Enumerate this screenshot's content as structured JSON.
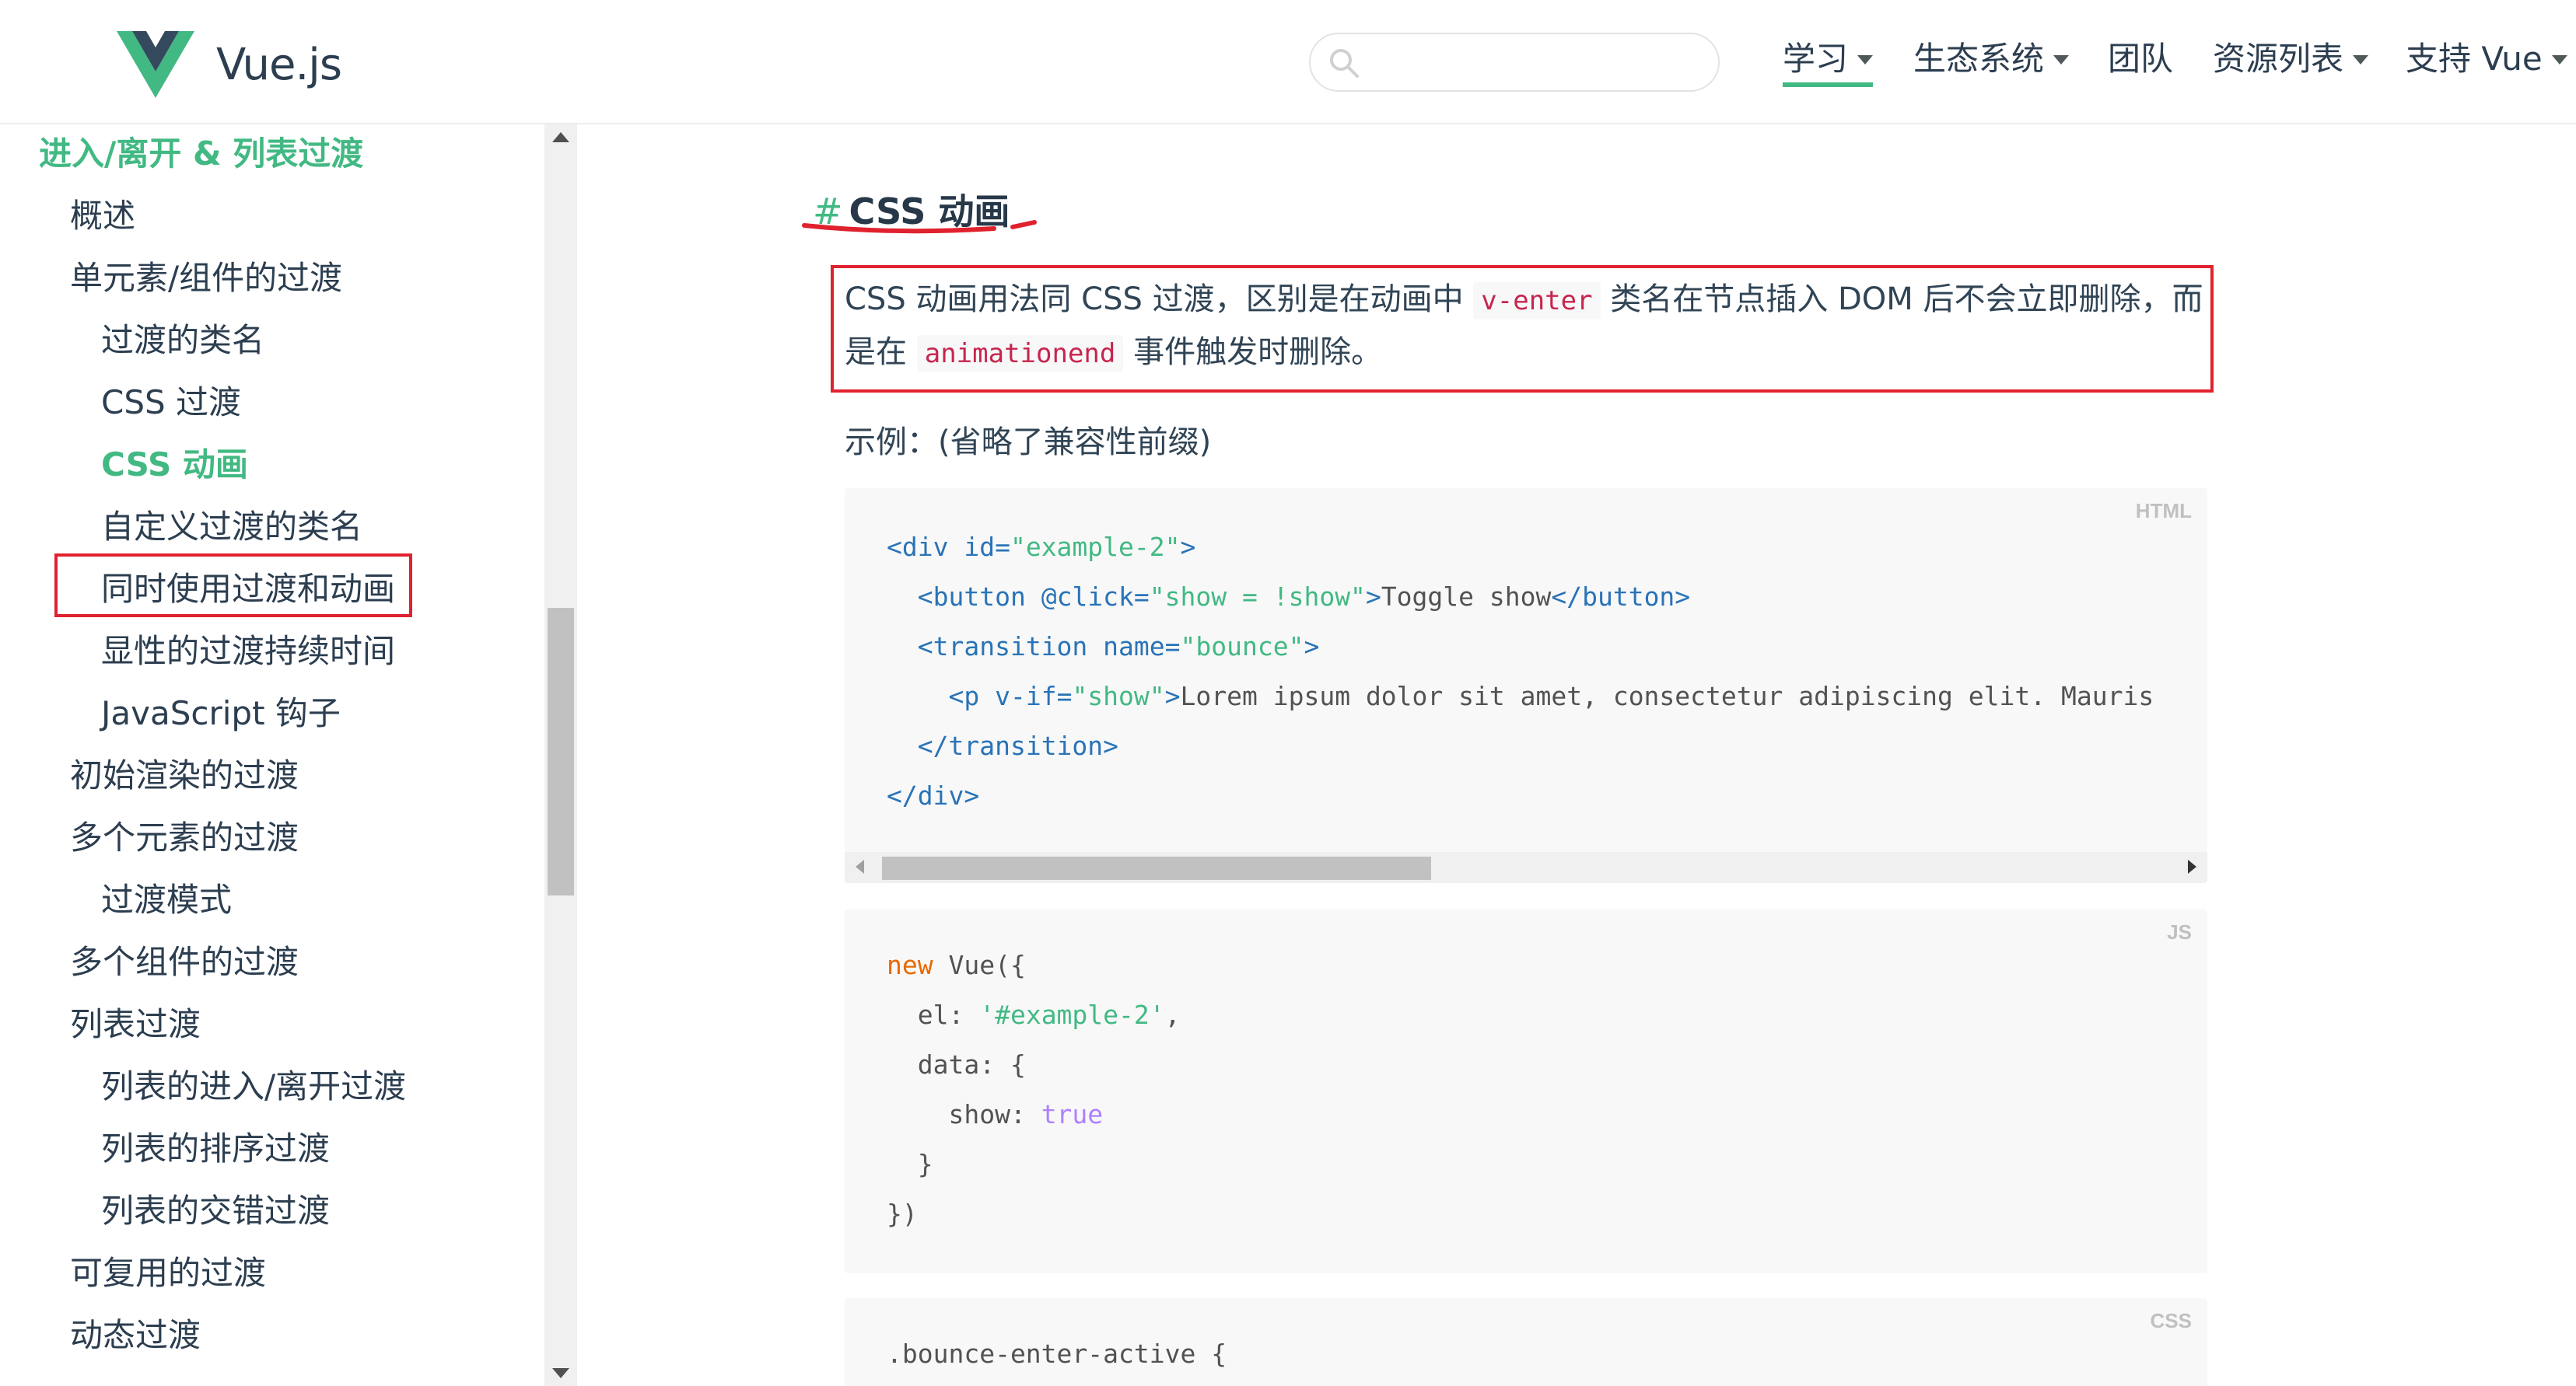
{
  "header": {
    "logo_text": "Vue.js",
    "search_placeholder": "",
    "nav": [
      {
        "label": "学习",
        "dropdown": true,
        "active": true
      },
      {
        "label": "生态系统",
        "dropdown": true,
        "active": false
      },
      {
        "label": "团队",
        "dropdown": false,
        "active": false
      },
      {
        "label": "资源列表",
        "dropdown": true,
        "active": false
      },
      {
        "label": "支持 Vue",
        "dropdown": true,
        "active": false
      }
    ]
  },
  "sidebar": {
    "section_title": "进入/离开 & 列表过渡",
    "items": [
      {
        "label": "概述",
        "level": 1
      },
      {
        "label": "单元素/组件的过渡",
        "level": 1
      },
      {
        "label": "过渡的类名",
        "level": 2
      },
      {
        "label": "CSS 过渡",
        "level": 2
      },
      {
        "label": "CSS 动画",
        "level": 2,
        "active": true
      },
      {
        "label": "自定义过渡的类名",
        "level": 2
      },
      {
        "label": "同时使用过渡和动画",
        "level": 2
      },
      {
        "label": "显性的过渡持续时间",
        "level": 2
      },
      {
        "label": "JavaScript 钩子",
        "level": 2
      },
      {
        "label": "初始渲染的过渡",
        "level": 1
      },
      {
        "label": "多个元素的过渡",
        "level": 1
      },
      {
        "label": "过渡模式",
        "level": 2
      },
      {
        "label": "多个组件的过渡",
        "level": 1
      },
      {
        "label": "列表过渡",
        "level": 1
      },
      {
        "label": "列表的进入/离开过渡",
        "level": 2
      },
      {
        "label": "列表的排序过渡",
        "level": 2
      },
      {
        "label": "列表的交错过渡",
        "level": 2
      },
      {
        "label": "可复用的过渡",
        "level": 1
      },
      {
        "label": "动态过渡",
        "level": 1
      }
    ]
  },
  "main": {
    "heading_hash": "#",
    "heading": "CSS 动画",
    "paragraph": {
      "part1": "CSS 动画用法同 CSS 过渡，区别是在动画中 ",
      "code1": "v-enter",
      "part2": " 类名在节点插入 DOM 后不会立即删除，而是在 ",
      "code2": "animationend",
      "part3": " 事件触发时删除。"
    },
    "example_label": "示例：(省略了兼容性前缀)",
    "code_html": {
      "lang": "HTML",
      "lines": [
        [
          [
            "tag",
            "<div "
          ],
          [
            "attr",
            "id="
          ],
          [
            "str",
            "\"example-2\""
          ],
          [
            "tag",
            ">"
          ]
        ],
        [
          [
            "text",
            "  "
          ],
          [
            "tag",
            "<button "
          ],
          [
            "attr",
            "@click="
          ],
          [
            "str",
            "\"show = !show\""
          ],
          [
            "tag",
            ">"
          ],
          [
            "text",
            "Toggle show"
          ],
          [
            "tag",
            "</button>"
          ]
        ],
        [
          [
            "text",
            "  "
          ],
          [
            "tag",
            "<transition "
          ],
          [
            "attr",
            "name="
          ],
          [
            "str",
            "\"bounce\""
          ],
          [
            "tag",
            ">"
          ]
        ],
        [
          [
            "text",
            "    "
          ],
          [
            "tag",
            "<p "
          ],
          [
            "attr",
            "v-if="
          ],
          [
            "str",
            "\"show\""
          ],
          [
            "tag",
            ">"
          ],
          [
            "text",
            "Lorem ipsum dolor sit amet, consectetur adipiscing elit. Mauris"
          ]
        ],
        [
          [
            "text",
            "  "
          ],
          [
            "tag",
            "</transition>"
          ]
        ],
        [
          [
            "tag",
            "</div>"
          ]
        ]
      ]
    },
    "code_js": {
      "lang": "JS",
      "lines": [
        [
          [
            "kw",
            "new "
          ],
          [
            "text",
            "Vue({"
          ]
        ],
        [
          [
            "text",
            "  el: "
          ],
          [
            "str",
            "'#example-2'"
          ],
          [
            "text",
            ","
          ]
        ],
        [
          [
            "text",
            "  data: {"
          ]
        ],
        [
          [
            "text",
            "    show: "
          ],
          [
            "bool",
            "true"
          ]
        ],
        [
          [
            "text",
            "  }"
          ]
        ],
        [
          [
            "text",
            "})"
          ]
        ]
      ]
    },
    "code_css": {
      "lang": "CSS",
      "lines": [
        [
          [
            "text",
            ".bounce-enter-active {"
          ]
        ]
      ]
    }
  },
  "colors": {
    "accent": "#42b983",
    "highlight_box": "#e0222e",
    "text": "#2c3e50"
  }
}
